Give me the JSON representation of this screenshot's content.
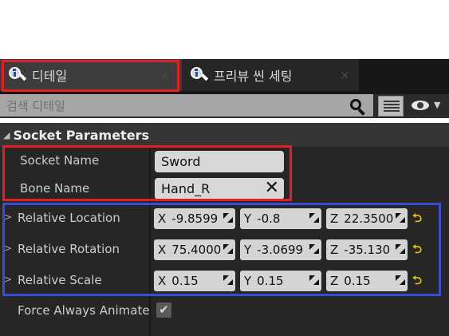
{
  "tabs": [
    {
      "label": "디테일",
      "close": "×",
      "icon": "details-magnifier-icon",
      "active": true
    },
    {
      "label": "프리뷰 씬 세팅",
      "close": "×",
      "icon": "details-magnifier-icon",
      "active": false
    }
  ],
  "search": {
    "placeholder": "검색 디테일",
    "icons": [
      "search-icon",
      "view-options-grid-icon",
      "visibility-eye-icon",
      "dropdown-caret-icon"
    ]
  },
  "category": {
    "expander": "◢",
    "title": "Socket Parameters"
  },
  "props": {
    "socket_name": {
      "label": "Socket Name",
      "value": "Sword"
    },
    "bone_name": {
      "label": "Bone Name",
      "value": "Hand_R",
      "clear": "✕"
    },
    "relative_location": {
      "expander": ">",
      "label": "Relative Location",
      "x": "-9.8599",
      "y": "-0.8",
      "z": "22.3500"
    },
    "relative_rotation": {
      "expander": ">",
      "label": "Relative Rotation",
      "x": "75.4000",
      "y": "-3.0699",
      "z": "-35.130"
    },
    "relative_scale": {
      "expander": ">",
      "label": "Relative Scale",
      "x": "0.15",
      "y": "0.15",
      "z": "0.15"
    },
    "force_always_animated": {
      "label": "Force Always Animate",
      "checked": true,
      "check": "✔"
    }
  },
  "axis": {
    "x": "X",
    "y": "Y",
    "z": "Z"
  },
  "reset_glyph": "⮌",
  "colors": {
    "highlight_red": "#e31e24",
    "highlight_blue": "#3a4ccf",
    "reset_yellow": "#e8c300",
    "panel_bg": "#262626"
  }
}
